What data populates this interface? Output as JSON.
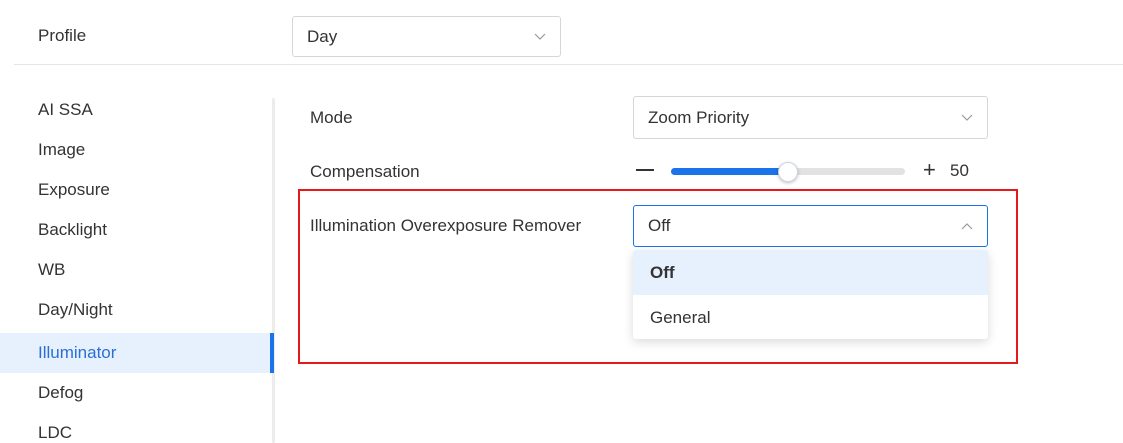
{
  "profile": {
    "label": "Profile",
    "value": "Day"
  },
  "sidebar": {
    "items": [
      {
        "label": "AI SSA"
      },
      {
        "label": "Image"
      },
      {
        "label": "Exposure"
      },
      {
        "label": "Backlight"
      },
      {
        "label": "WB"
      },
      {
        "label": "Day/Night"
      },
      {
        "label": "Illuminator",
        "active": true
      },
      {
        "label": "Defog"
      },
      {
        "label": "LDC"
      }
    ]
  },
  "form": {
    "mode": {
      "label": "Mode",
      "value": "Zoom Priority"
    },
    "compensation": {
      "label": "Compensation",
      "minus_symbol": "—",
      "plus_symbol": "+",
      "value": "50",
      "level_fraction": 0.5
    },
    "illumination_overexposure_remover": {
      "label": "Illumination Overexposure Remover",
      "value": "Off",
      "options": [
        "Off",
        "General"
      ],
      "selected_option": "Off"
    }
  },
  "colors": {
    "accent": "#1a73e8",
    "highlight_border": "#e4191b",
    "active_nav_bg": "#e6f1fd"
  },
  "icons": {
    "select_closed": "chevron-down-icon",
    "select_open": "chevron-up-icon"
  }
}
